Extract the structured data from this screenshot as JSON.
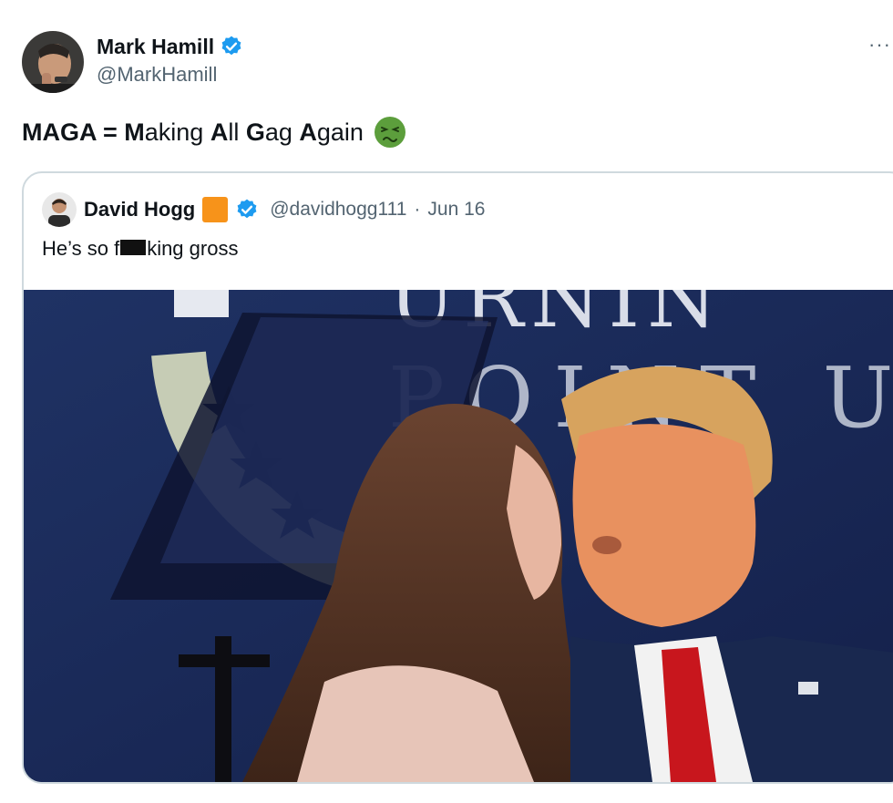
{
  "tweet": {
    "author": {
      "name": "Mark Hamill",
      "handle": "@MarkHamill",
      "verified": true
    },
    "more_label": "···",
    "text_parts": [
      {
        "text": "MAGA = ",
        "bold": true
      },
      {
        "text": "M",
        "bold": true
      },
      {
        "text": "aking ",
        "bold": false
      },
      {
        "text": "A",
        "bold": true
      },
      {
        "text": "ll ",
        "bold": false
      },
      {
        "text": "G",
        "bold": true
      },
      {
        "text": "ag ",
        "bold": false
      },
      {
        "text": "A",
        "bold": true
      },
      {
        "text": "gain",
        "bold": false
      }
    ],
    "emoji": "nauseated-face-icon"
  },
  "quote": {
    "author": {
      "name": "David Hogg",
      "handle": "@davidhogg111",
      "separator": "·",
      "date": "Jun 16",
      "badge_color": "#f7931a",
      "verified": true
    },
    "text_before": "He’s so f",
    "text_after": "king gross",
    "media": {
      "kind": "video-still",
      "backdrop_letters_top": "URNIN",
      "backdrop_letters_mid": "POINT U"
    }
  },
  "colors": {
    "verified_blue": "#1d9bf0",
    "secondary_text": "#536471",
    "border": "#cfd9de",
    "emoji_green": "#5c9e3c"
  }
}
